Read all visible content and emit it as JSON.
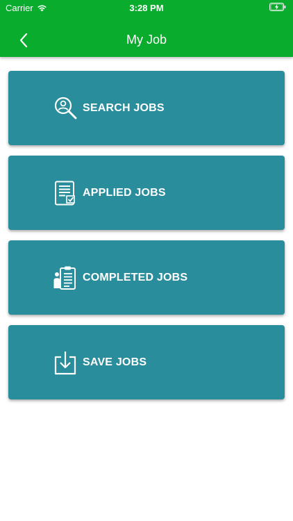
{
  "status_bar": {
    "carrier": "Carrier",
    "time": "3:28 PM"
  },
  "header": {
    "title": "My Job"
  },
  "colors": {
    "brand": "#09ac2c",
    "card": "#2a8d9b",
    "text": "#ffffff"
  },
  "menu": [
    {
      "label": "SEARCH JOBS",
      "icon": "search-user-icon"
    },
    {
      "label": "APPLIED JOBS",
      "icon": "document-check-icon"
    },
    {
      "label": "COMPLETED JOBS",
      "icon": "clipboard-person-icon"
    },
    {
      "label": "SAVE JOBS",
      "icon": "download-tray-icon"
    }
  ]
}
